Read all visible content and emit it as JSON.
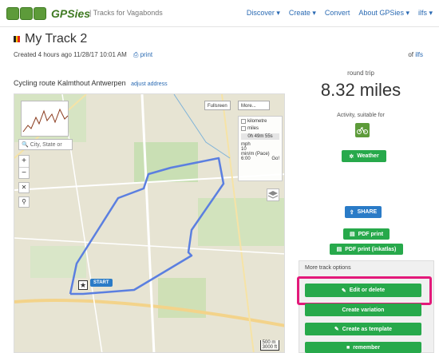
{
  "header": {
    "logo_text": "GPSies",
    "tagline": "| Tracks for Vagabonds",
    "nav": [
      "Discover ▾",
      "Create ▾",
      "Convert",
      "About GPSies ▾",
      "ilfs ▾"
    ]
  },
  "track": {
    "title": "My Track 2",
    "created": "Created 4 hours ago 11/28/17 10:01 AM",
    "print_label": "print",
    "owner_prefix": "of",
    "owner": "ilfs",
    "route_name": "Cycling route Kalmthout Antwerpen",
    "adjust_label": "adjust address"
  },
  "map": {
    "search_placeholder": "City, State or",
    "zoom_in": "+",
    "zoom_out": "−",
    "fullscreen_label": "Fullsreen",
    "more_label": "More...",
    "units": {
      "kilometre": "kilometre",
      "miles": "miles",
      "time": "0h 49m 55s",
      "speed_unit": "mph",
      "speed_value": "10",
      "pace_unit": "min/m (Pace)",
      "pace_value": "6:00",
      "go_label": "Go!"
    },
    "start_label": "START",
    "scale_m": "500 m",
    "scale_ft": "3000 ft"
  },
  "stats": {
    "trip_type": "round trip",
    "distance": "8.32 miles",
    "activity_label": "Activity, suitable for"
  },
  "actions": {
    "weather": "Weather",
    "share": "SHARE",
    "pdf_print": "PDF print",
    "pdf_print_inkatlas": "PDF print (inkatlas)",
    "more_options": "More track options",
    "edit": "Edit or delete",
    "create_variation": "Create variation",
    "create_template": "Create as template",
    "remember": "remember"
  },
  "colors": {
    "brand_green": "#27a94b",
    "share_blue": "#2a7bc7",
    "highlight": "#e3197a",
    "route_line": "#5b7fe0"
  }
}
